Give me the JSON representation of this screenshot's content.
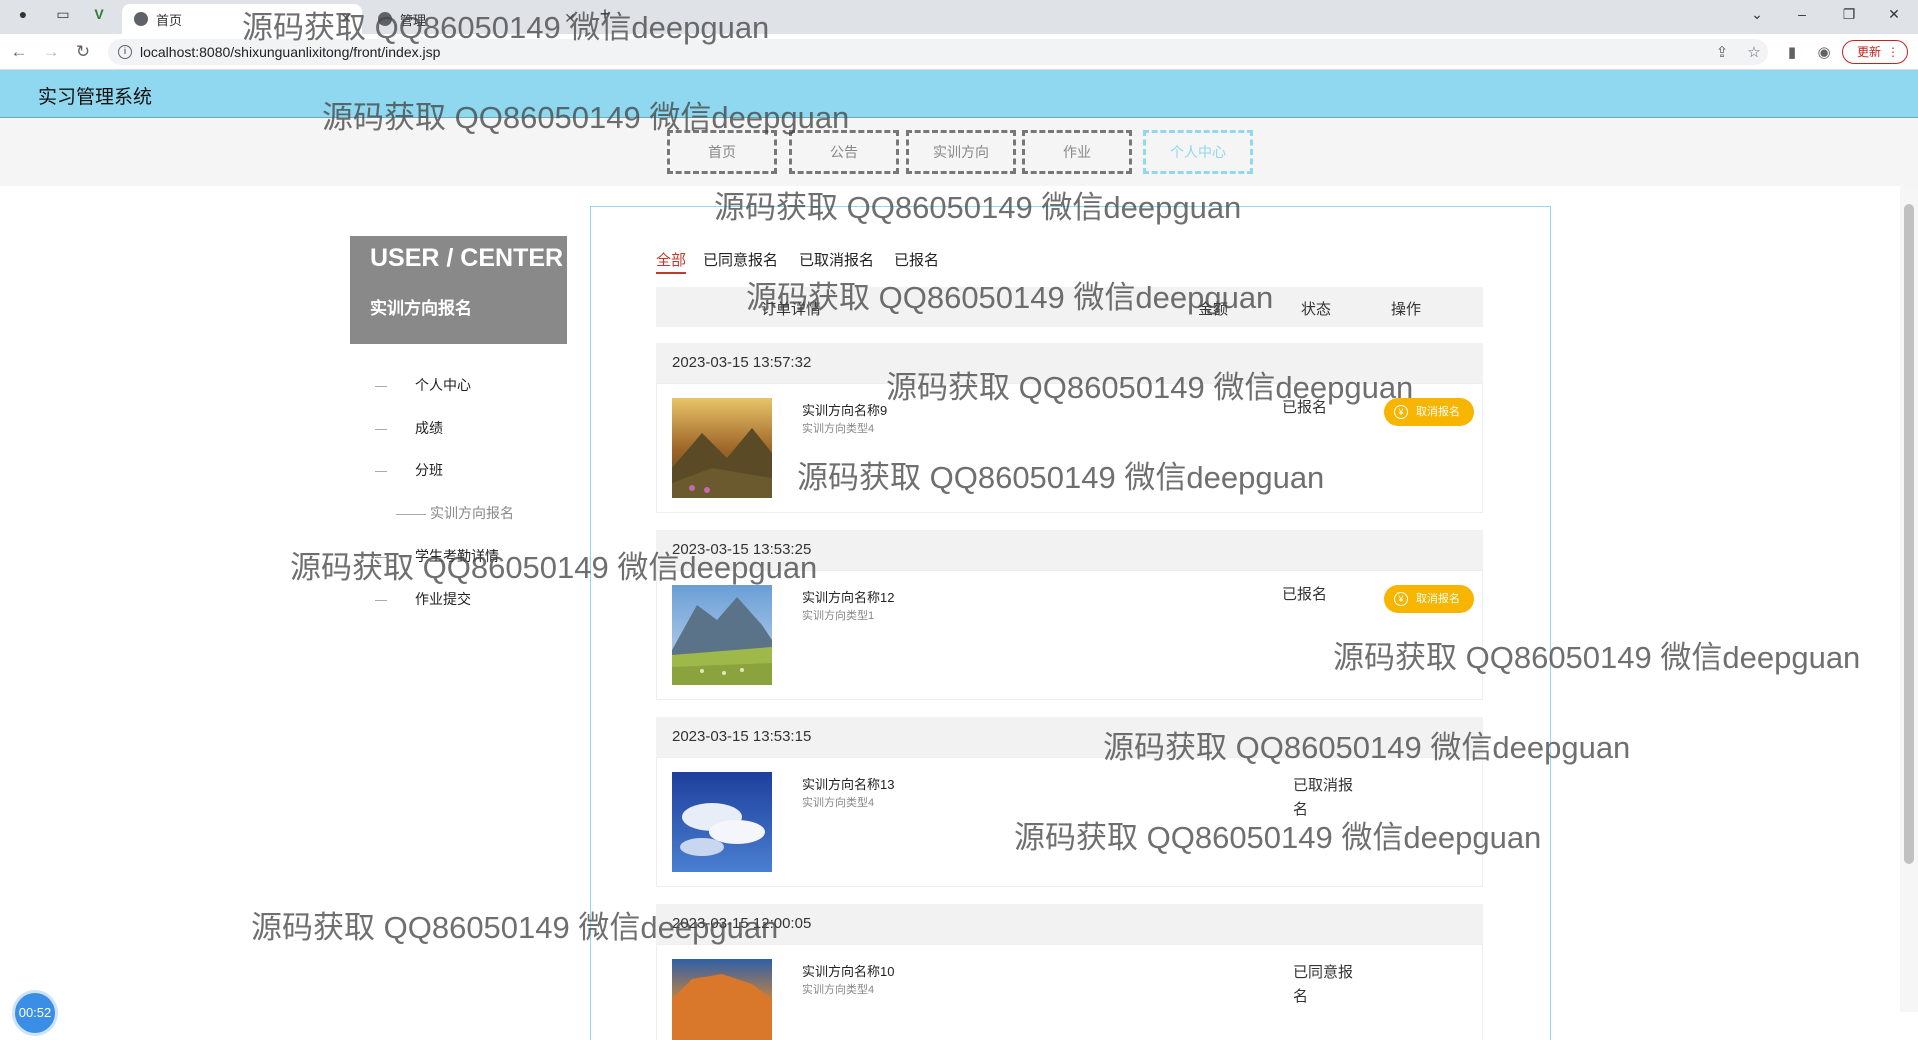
{
  "browser": {
    "tabs": [
      {
        "title": "首页",
        "active": true
      },
      {
        "title": "管理",
        "active": false
      }
    ],
    "url": "localhost:8080/shixunguanlixitong/front/index.jsp",
    "update_label": "更新"
  },
  "header": {
    "site_title": "实习管理系统"
  },
  "nav": {
    "items": [
      "首页",
      "公告",
      "实训方向",
      "作业",
      "个人中心"
    ],
    "active": "个人中心"
  },
  "sidebar": {
    "title": "USER / CENTER",
    "subtitle": "实训方向报名",
    "items": [
      "个人中心",
      "成绩",
      "分班",
      "实训方向报名",
      "学生考勤详情",
      "作业提交"
    ]
  },
  "filter_tabs": {
    "items": [
      "全部",
      "已同意报名",
      "已取消报名",
      "已报名"
    ],
    "active": "全部"
  },
  "table_headers": {
    "detail": "订单详情",
    "amount": "金额",
    "status": "状态",
    "action": "操作"
  },
  "orders": [
    {
      "time": "2023-03-15 13:57:32",
      "name": "实训方向名称9",
      "type": "实训方向类型4",
      "status": "已报名",
      "action": "取消报名",
      "image": "golden-mountain-landscape"
    },
    {
      "time": "2023-03-15 13:53:25",
      "name": "实训方向名称12",
      "type": "实训方向类型1",
      "status": "已报名",
      "action": "取消报名",
      "image": "green-mountain-meadow"
    },
    {
      "time": "2023-03-15 13:53:15",
      "name": "实训方向名称13",
      "type": "实训方向类型4",
      "status": "已取消报名",
      "image": "blue-sky-clouds"
    },
    {
      "time": "2023-03-15 12:00:05",
      "name": "实训方向名称10",
      "type": "实训方向类型4",
      "status": "已同意报名",
      "image": "orange-sunset-rock"
    }
  ],
  "watermark": "源码获取 QQ86050149 微信deepguan",
  "recorder_time": "00:52",
  "colors": {
    "header_bg": "#8fd8f0",
    "active_tab": "#c0392b",
    "cancel_button": "#f7b500",
    "sidebar_box": "#898989"
  }
}
